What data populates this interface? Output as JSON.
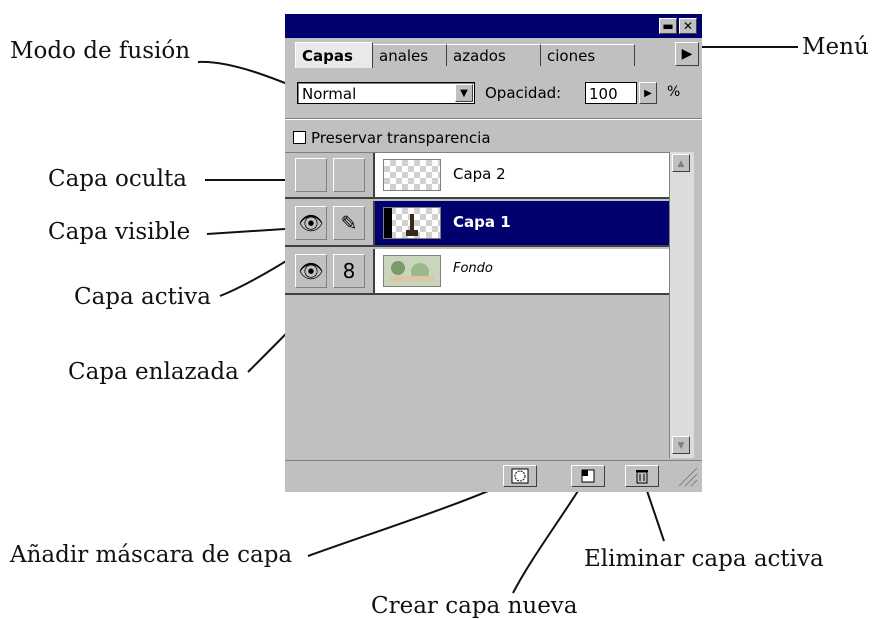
{
  "panel": {
    "tabs": [
      "Capas",
      "anales",
      "azados",
      "ciones"
    ],
    "menu_arrow_icon": "triangle-right-icon",
    "blend_mode": "Normal",
    "opacity_label": "Opacidad:",
    "opacity_value": "100",
    "opacity_unit": "%",
    "preserve_label": "Preservar transparencia",
    "layers": [
      {
        "name": "Capa 2",
        "visible": false,
        "active": false,
        "linked": false
      },
      {
        "name": "Capa 1",
        "visible": true,
        "active": true,
        "linked": false
      },
      {
        "name": "Fondo",
        "visible": true,
        "active": false,
        "linked": true
      }
    ],
    "bottom_icons": [
      "mask-icon",
      "new-layer-icon",
      "trash-icon"
    ]
  },
  "callouts": {
    "modo_fusion": "Modo de fusión",
    "menu": "Menú",
    "capa_oculta": "Capa oculta",
    "capa_visible": "Capa visible",
    "capa_activa": "Capa activa",
    "capa_enlazada": "Capa enlazada",
    "anadir_mascara": "Añadir máscara de capa",
    "eliminar_capa": "Eliminar capa activa",
    "crear_capa": "Crear capa nueva"
  },
  "colors": {
    "titlebar": "#00006e",
    "panel_bg": "#c0c0c0",
    "active_layer": "#00006e"
  }
}
